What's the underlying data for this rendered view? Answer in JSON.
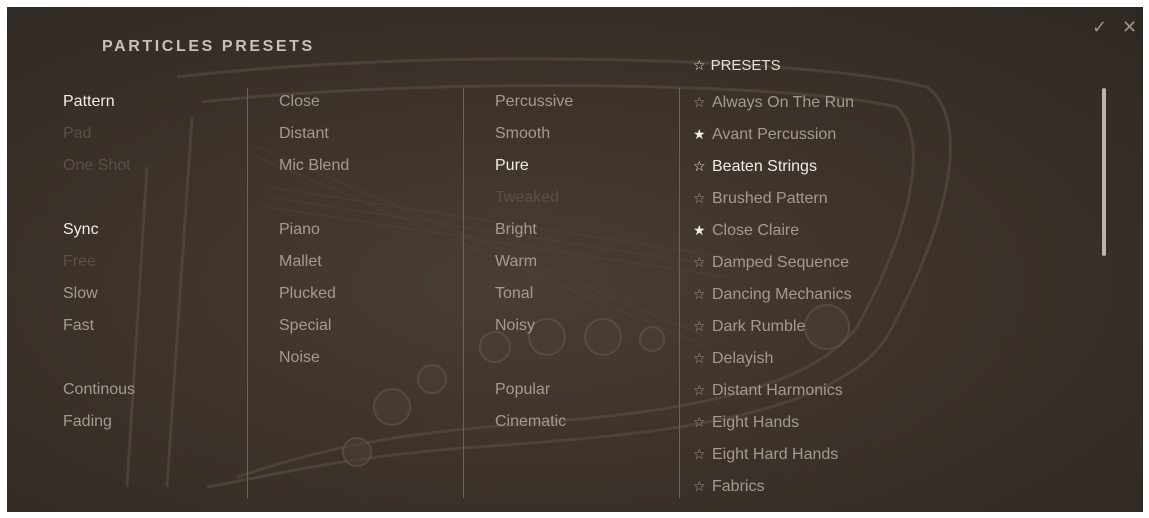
{
  "title": "PARTICLES PRESETS",
  "window_controls": {
    "confirm_icon": "checkmark-icon",
    "close_icon": "close-icon",
    "confirm_glyph": "✓",
    "close_glyph": "✕"
  },
  "columns": [
    {
      "id": "col1",
      "items": [
        {
          "label": "Pattern",
          "state": "active"
        },
        {
          "label": "Pad",
          "state": "disabled"
        },
        {
          "label": "One Shot",
          "state": "disabled"
        },
        {
          "label": "",
          "state": "gap"
        },
        {
          "label": "Sync",
          "state": "active"
        },
        {
          "label": "Free",
          "state": "disabled"
        },
        {
          "label": "Slow",
          "state": "normal"
        },
        {
          "label": "Fast",
          "state": "normal"
        },
        {
          "label": "",
          "state": "gap"
        },
        {
          "label": "Continous",
          "state": "normal"
        },
        {
          "label": "Fading",
          "state": "normal"
        }
      ]
    },
    {
      "id": "col2",
      "items": [
        {
          "label": "Close",
          "state": "normal"
        },
        {
          "label": "Distant",
          "state": "normal"
        },
        {
          "label": "Mic Blend",
          "state": "normal"
        },
        {
          "label": "",
          "state": "gap"
        },
        {
          "label": "Piano",
          "state": "normal"
        },
        {
          "label": "Mallet",
          "state": "normal"
        },
        {
          "label": "Plucked",
          "state": "normal"
        },
        {
          "label": "Special",
          "state": "normal"
        },
        {
          "label": "Noise",
          "state": "normal"
        }
      ]
    },
    {
      "id": "col3",
      "items": [
        {
          "label": "Percussive",
          "state": "normal"
        },
        {
          "label": "Smooth",
          "state": "normal"
        },
        {
          "label": "Pure",
          "state": "active"
        },
        {
          "label": "Tweaked",
          "state": "disabled"
        },
        {
          "label": "Bright",
          "state": "normal"
        },
        {
          "label": "Warm",
          "state": "normal"
        },
        {
          "label": "Tonal",
          "state": "normal"
        },
        {
          "label": "Noisy",
          "state": "normal"
        },
        {
          "label": "",
          "state": "gap"
        },
        {
          "label": "Popular",
          "state": "normal"
        },
        {
          "label": "Cinematic",
          "state": "normal"
        }
      ]
    }
  ],
  "presets": {
    "header_label": "PRESETS",
    "header_star": "☆",
    "items": [
      {
        "label": "Always On The Run",
        "starred": false,
        "selected": false
      },
      {
        "label": "Avant Percussion",
        "starred": true,
        "selected": false
      },
      {
        "label": "Beaten Strings",
        "starred": false,
        "selected": true
      },
      {
        "label": "Brushed Pattern",
        "starred": false,
        "selected": false
      },
      {
        "label": "Close Claire",
        "starred": true,
        "selected": false
      },
      {
        "label": "Damped Sequence",
        "starred": false,
        "selected": false
      },
      {
        "label": "Dancing Mechanics",
        "starred": false,
        "selected": false
      },
      {
        "label": "Dark Rumble",
        "starred": false,
        "selected": false
      },
      {
        "label": "Delayish",
        "starred": false,
        "selected": false
      },
      {
        "label": "Distant Harmonics",
        "starred": false,
        "selected": false
      },
      {
        "label": "Eight Hands",
        "starred": false,
        "selected": false
      },
      {
        "label": "Eight Hard Hands",
        "starred": false,
        "selected": false
      },
      {
        "label": "Fabrics",
        "starred": false,
        "selected": false
      }
    ],
    "star_filled": "★",
    "star_empty": "☆"
  },
  "colors": {
    "background": "#3d332b",
    "text_normal": "#a39b91",
    "text_active": "#f1ede6",
    "text_disabled": "#5a5048",
    "divider": "#6e6358"
  }
}
